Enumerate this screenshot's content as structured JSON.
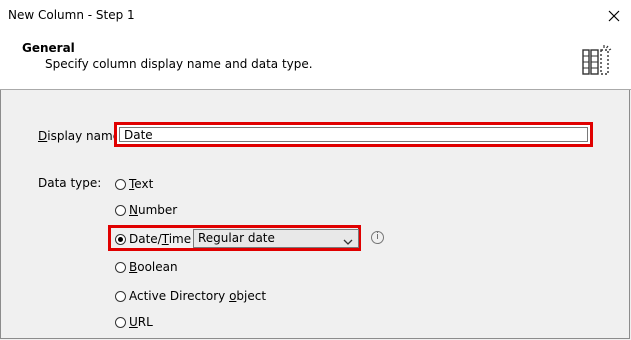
{
  "window": {
    "title": "New Column - Step 1"
  },
  "header": {
    "title": "General",
    "subtitle": "Specify column display name and data type.",
    "icon": "table-column-icon"
  },
  "form": {
    "display_name": {
      "label_prefix": "D",
      "label_rest": "isplay name:",
      "value": "Date"
    },
    "data_type": {
      "label": "Data type:",
      "options": [
        {
          "u": "T",
          "rest": "ext",
          "selected": false
        },
        {
          "u": "N",
          "rest": "umber",
          "selected": false
        },
        {
          "pre": "Date/",
          "u": "T",
          "rest": "ime",
          "selected": true
        },
        {
          "u": "B",
          "rest": "oolean",
          "selected": false
        },
        {
          "pre": "Active Directory ",
          "u": "o",
          "rest": "bject",
          "selected": false
        },
        {
          "u": "U",
          "rest": "RL",
          "selected": false
        }
      ],
      "datetime_format": "Regular date"
    },
    "info_icon": "info-icon"
  },
  "colors": {
    "highlight": "#e00000"
  }
}
